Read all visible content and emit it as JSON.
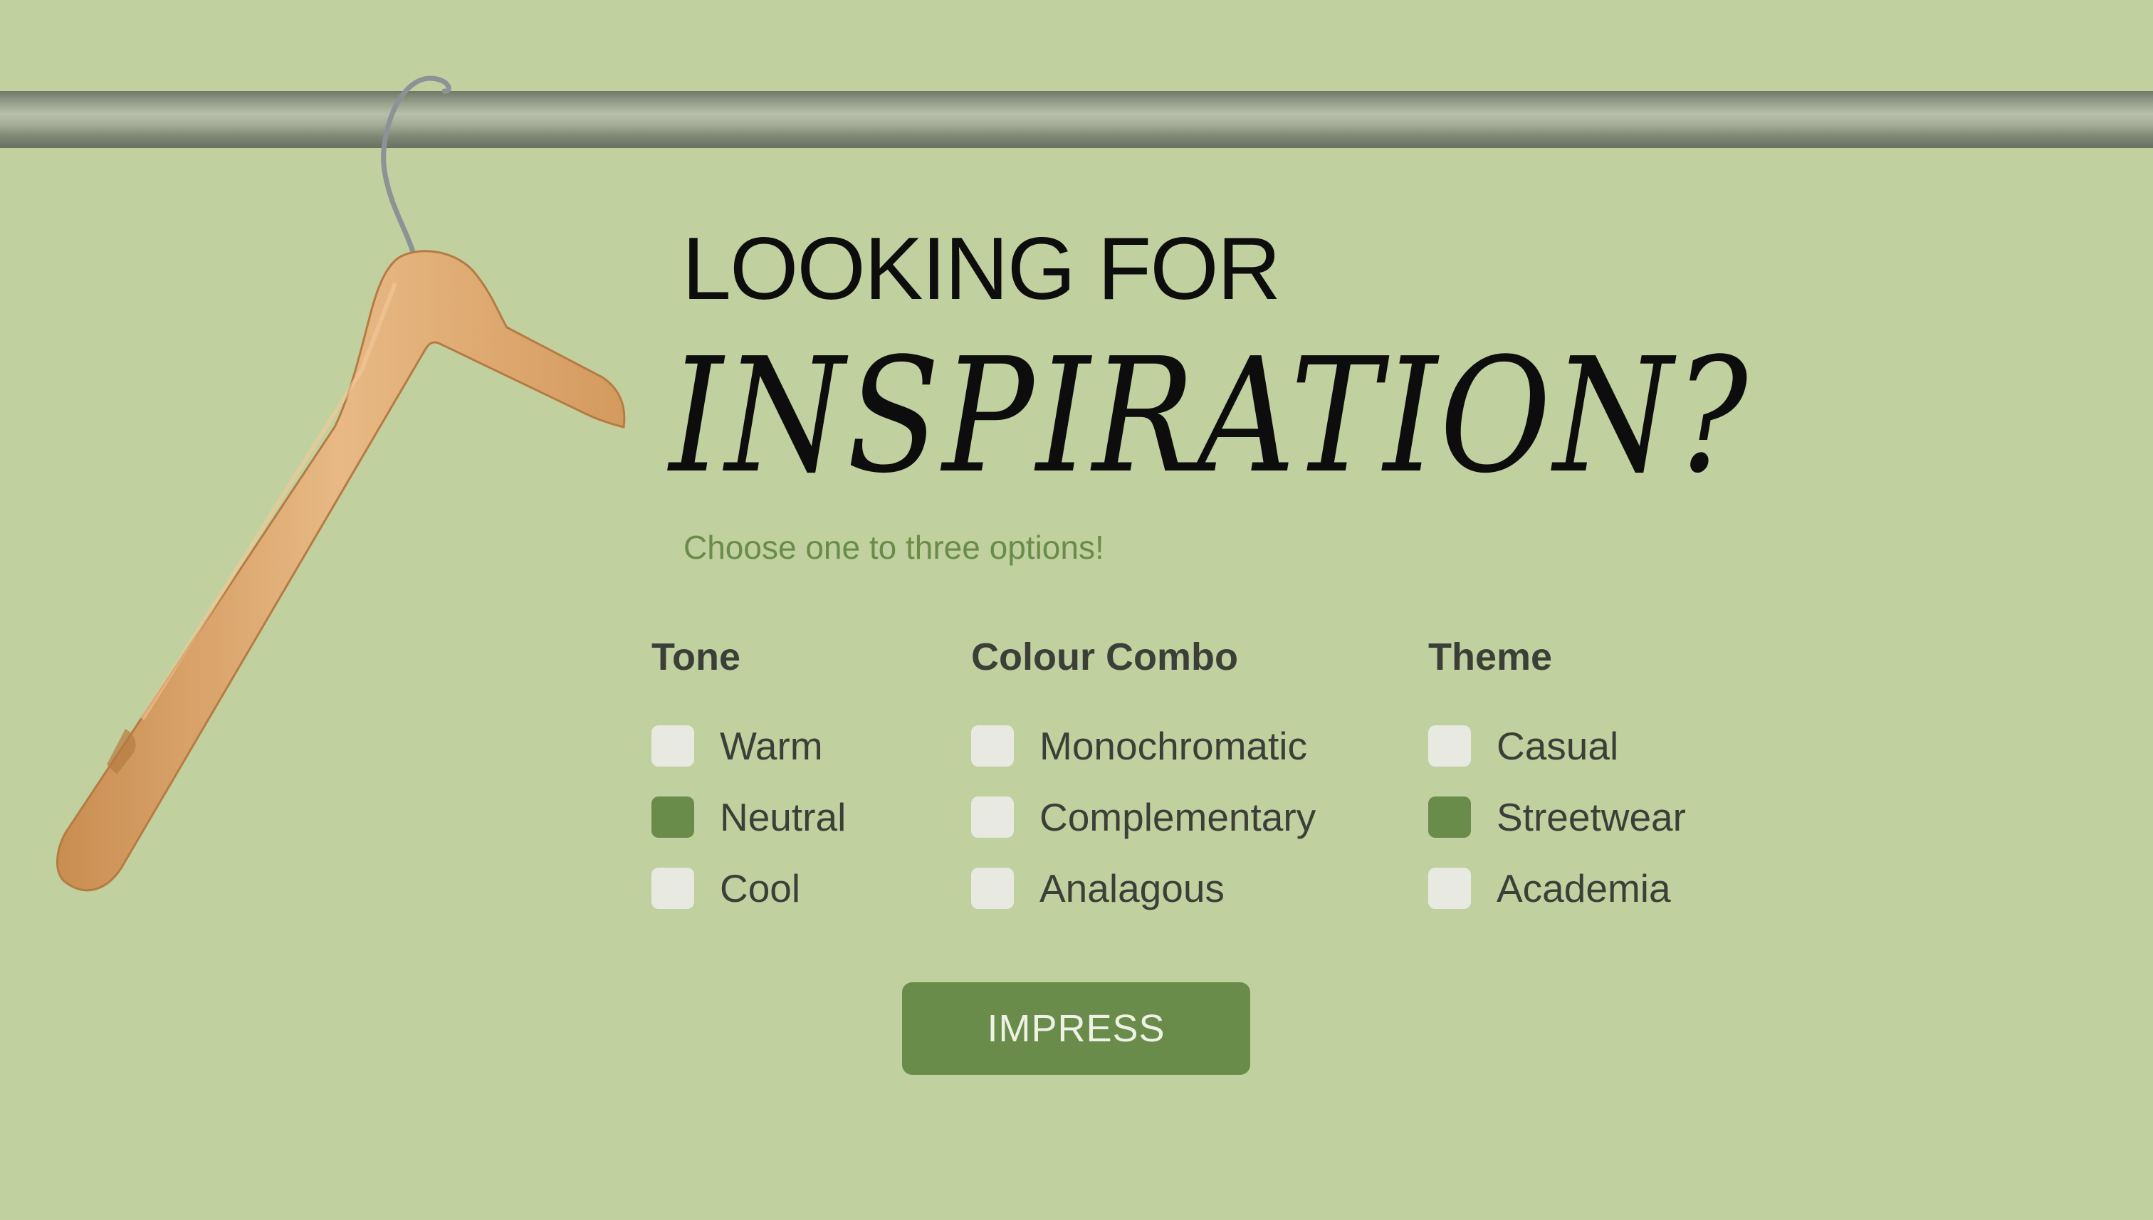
{
  "colors": {
    "background": "#c0d09e",
    "accent": "#6a8c4a",
    "unchecked": "#e8eae2",
    "text": "#3c3f38"
  },
  "heading": {
    "line1": "LOOKING FOR",
    "line2": "INSPIRATION?"
  },
  "subtitle": "Choose one to three options!",
  "groups": [
    {
      "title": "Tone",
      "options": [
        {
          "label": "Warm",
          "checked": false
        },
        {
          "label": "Neutral",
          "checked": true
        },
        {
          "label": "Cool",
          "checked": false
        }
      ]
    },
    {
      "title": "Colour Combo",
      "options": [
        {
          "label": "Monochromatic",
          "checked": false
        },
        {
          "label": "Complementary",
          "checked": false
        },
        {
          "label": "Analagous",
          "checked": false
        }
      ]
    },
    {
      "title": "Theme",
      "options": [
        {
          "label": "Casual",
          "checked": false
        },
        {
          "label": "Streetwear",
          "checked": true
        },
        {
          "label": "Academia",
          "checked": false
        }
      ]
    }
  ],
  "submit_label": "IMPRESS",
  "icons": {
    "rail": "clothes-rail",
    "hanger": "wooden-hanger-icon"
  }
}
